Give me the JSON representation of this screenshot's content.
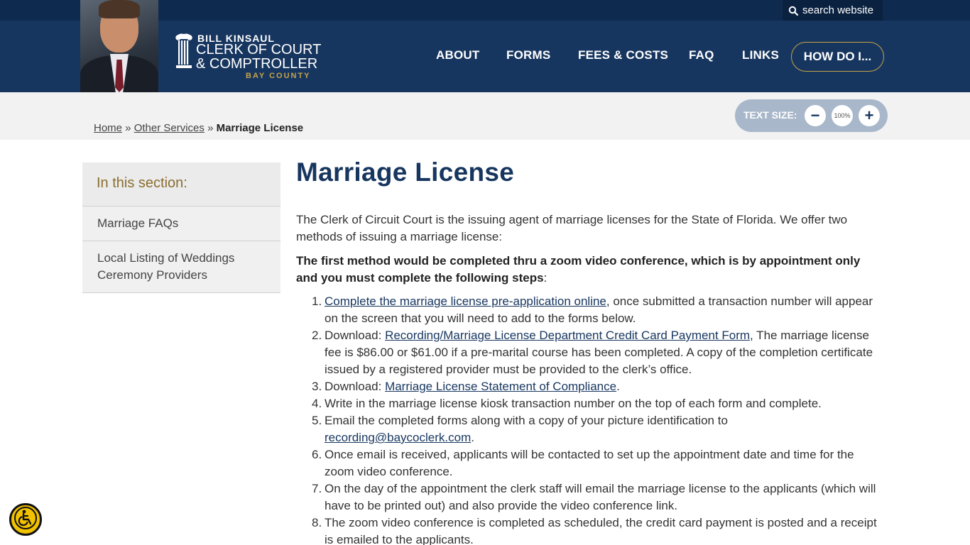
{
  "search": {
    "label": "search website"
  },
  "logo": {
    "line1": "BILL KINSAUL",
    "line2": "CLERK OF COURT",
    "line3": "& COMPTROLLER",
    "line4": "BAY COUNTY"
  },
  "nav": {
    "items": [
      "ABOUT",
      "FORMS",
      "FEES & COSTS",
      "FAQ",
      "LINKS"
    ],
    "how_do_i": "HOW DO I..."
  },
  "breadcrumb": {
    "home": "Home",
    "sep1": " » ",
    "parent": "Other Services",
    "sep2": " » ",
    "current": "Marriage License"
  },
  "text_size": {
    "label": "TEXT SIZE:",
    "minus": "−",
    "value": "100%",
    "plus": "+"
  },
  "sidebar": {
    "heading": "In this section:",
    "items": [
      "Marriage FAQs",
      "Local Listing of Weddings Ceremony Providers"
    ]
  },
  "main": {
    "title": "Marriage License",
    "intro": "The Clerk of Circuit Court is the issuing agent of marriage licenses for the State of Florida. We offer two methods of issuing a marriage license:",
    "lead": "The first method would be completed thru a zoom video conference, which is by appointment only and you must complete the following steps",
    "lead_colon": ":",
    "steps": [
      {
        "num": "1.",
        "pre": "",
        "link": "Complete the marriage license pre-application online",
        "post": ", once submitted a transaction number will appear on the screen that you will need to add to the forms below."
      },
      {
        "num": "2.",
        "pre": "Download: ",
        "link": "Recording/Marriage License Department Credit Card Payment Form",
        "post": ", The marriage license fee is $86.00 or $61.00 if a pre-marital course has been completed. A copy of the completion certificate issued by a registered provider must be provided to the clerk’s office."
      },
      {
        "num": "3.",
        "pre": "Download: ",
        "link": "Marriage License Statement of Compliance",
        "post": "."
      },
      {
        "num": "4.",
        "pre": "Write in the marriage license kiosk transaction number on the top of each form and complete.",
        "link": "",
        "post": ""
      },
      {
        "num": "5.",
        "pre": "Email the completed forms along with a copy of your picture identification to ",
        "link": "recording@baycoclerk.com",
        "post": "."
      },
      {
        "num": "6.",
        "pre": "Once email is received, applicants will be contacted to set up the appointment date and time for the zoom video conference.",
        "link": "",
        "post": ""
      },
      {
        "num": "7.",
        "pre": "On the day of the appointment the clerk staff will email the marriage license to the applicants (which will have to be printed out) and also provide the video conference link.",
        "link": "",
        "post": ""
      },
      {
        "num": "8.",
        "pre": "The zoom video conference is completed as scheduled, the credit card payment is posted and a receipt is emailed to the applicants.",
        "link": "",
        "post": ""
      }
    ]
  },
  "colors": {
    "header": "#17365f",
    "topbar": "#0f2a4f",
    "accent_gold": "#c6a34a",
    "band": "#f2f2f2",
    "a11y_yellow": "#f2c200"
  },
  "icons": {
    "search": "search-icon",
    "accessibility": "wheelchair-accessibility-icon"
  }
}
